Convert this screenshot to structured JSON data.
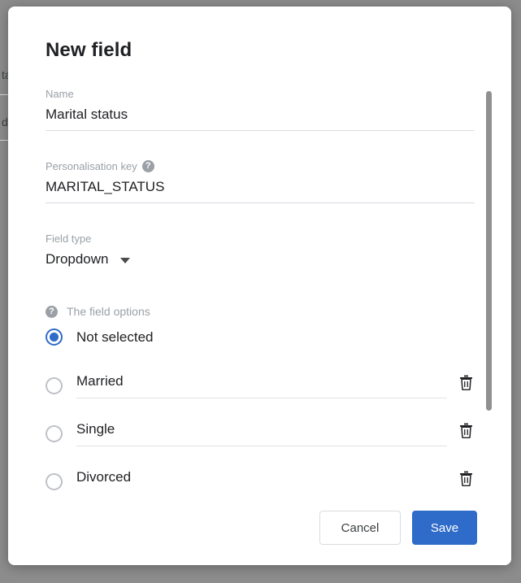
{
  "background_page": {
    "clipped_text_1": "ta",
    "clipped_text_2": "ds"
  },
  "modal": {
    "title": "New field",
    "fields": [
      {
        "label": "Name",
        "value": "Marital status",
        "has_help": false
      },
      {
        "label": "Personalisation key",
        "value": "MARITAL_STATUS",
        "has_help": true,
        "help_icon": "help-circle-icon"
      },
      {
        "label": "Field type",
        "value": "Dropdown",
        "has_help": false,
        "dropdown_icon": "chevron-down-icon"
      }
    ],
    "options_section": {
      "help_icon": "help-circle-icon",
      "label": "The field options",
      "options": [
        {
          "label": "Not selected",
          "selected": true,
          "deletable": false
        },
        {
          "label": "Married",
          "selected": false,
          "deletable": true,
          "delete_icon": "trash-icon"
        },
        {
          "label": "Single",
          "selected": false,
          "deletable": true,
          "delete_icon": "trash-icon"
        },
        {
          "label": "Divorced",
          "selected": false,
          "deletable": true,
          "delete_icon": "trash-icon"
        }
      ]
    },
    "footer": {
      "cancel_label": "Cancel",
      "save_label": "Save"
    },
    "scrollbar": {
      "visible": true
    }
  },
  "colors": {
    "accent_blue": "#2f6bc9",
    "backdrop": "#8c8c8c",
    "label_grey": "#9aa0a6",
    "text_dark": "#202124",
    "rule_grey": "#dadce0"
  }
}
